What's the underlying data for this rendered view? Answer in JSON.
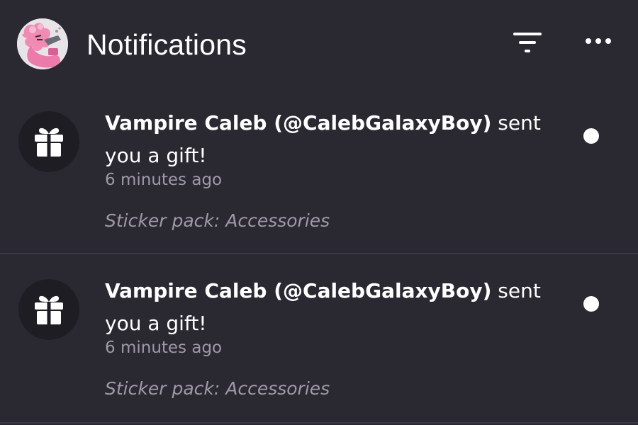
{
  "header": {
    "title": "Notifications",
    "avatar_icon": "profile-avatar",
    "filter_icon": "filter-icon",
    "more_icon": "more-options-icon"
  },
  "notifications": [
    {
      "icon": "gift-icon",
      "sender": "Vampire Caleb (@CalebGalaxyBoy)",
      "message": " sent you a gift!",
      "time": "6 minutes ago",
      "detail": "Sticker pack: Accessories",
      "unread": true
    },
    {
      "icon": "gift-icon",
      "sender": "Vampire Caleb (@CalebGalaxyBoy)",
      "message": " sent you a gift!",
      "time": "6 minutes ago",
      "detail": "Sticker pack: Accessories",
      "unread": true
    }
  ],
  "colors": {
    "background": "#2a2831",
    "icon_circle": "#1f1d24",
    "secondary_text": "#9d9aa5",
    "avatar_pink": "#f08cb4"
  }
}
